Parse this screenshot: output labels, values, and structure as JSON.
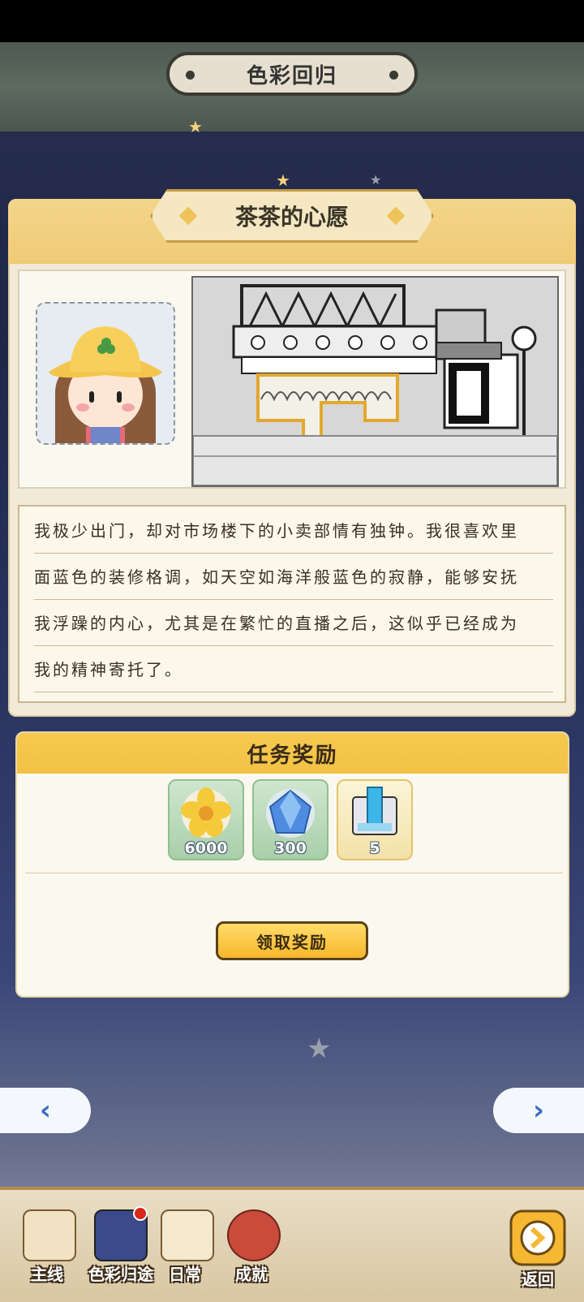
{
  "header": {
    "title": "色彩回归"
  },
  "card": {
    "ribbon_title": "茶茶的心愿"
  },
  "story": {
    "lines": [
      "我极少出门，却对市场楼下的小卖部情有独钟。我很喜欢里",
      "面蓝色的装修格调，如天空如海洋般蓝色的寂静，能够安抚",
      "我浮躁的内心，尤其是在繁忙的直播之后，这似乎已经成为",
      "我的精神寄托了。"
    ]
  },
  "reward": {
    "title": "任务奖励",
    "items": [
      {
        "icon": "yellow-flower-icon",
        "count": "6000"
      },
      {
        "icon": "blue-gem-icon",
        "count": "300"
      },
      {
        "icon": "blue-block-icon",
        "count": "5"
      }
    ],
    "claim_label": "领取奖励"
  },
  "nav": {
    "prev_icon": "chevron-left-icon",
    "next_icon": "chevron-right-icon",
    "prev_glyph": "‹",
    "next_glyph": "›"
  },
  "bottom_tabs": [
    {
      "label": "主线",
      "icon": "book-icon"
    },
    {
      "label": "色彩归途",
      "icon": "color-journey-icon"
    },
    {
      "label": "日常",
      "icon": "clock-icon"
    },
    {
      "label": "成就",
      "icon": "medal-icon"
    }
  ],
  "back": {
    "label": "返回",
    "icon": "return-arrow-icon"
  },
  "colors": {
    "accent": "#f6c94e",
    "card_bg": "#f2ead6",
    "nav_blue": "#3a6dc2"
  }
}
